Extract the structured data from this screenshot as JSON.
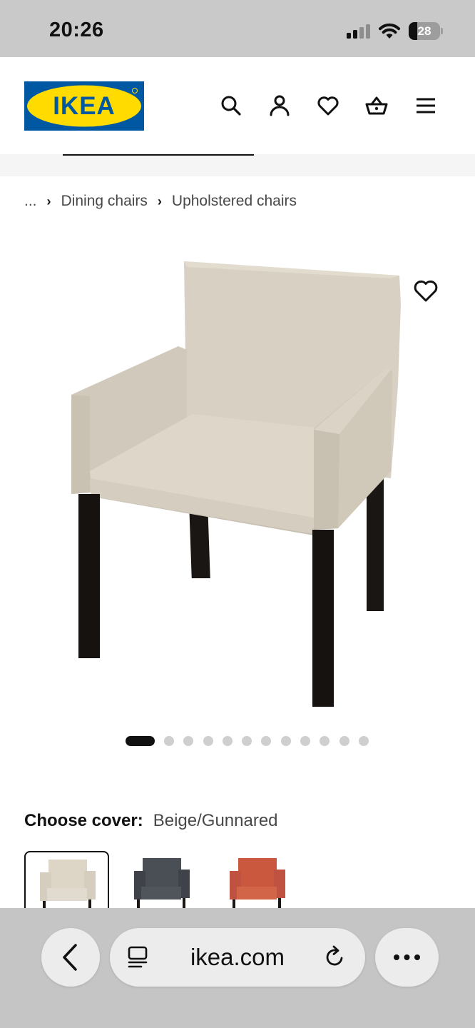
{
  "status_bar": {
    "time": "20:26",
    "battery_level": "28",
    "battery_fraction": 0.28,
    "signal_bars_active": 2,
    "signal_bars_total": 4
  },
  "header": {
    "logo_text": "IKEA",
    "brand_colors": {
      "blue": "#0058a3",
      "yellow": "#ffdb00"
    },
    "icons": [
      "search-icon",
      "account-icon",
      "heart-icon",
      "basket-icon",
      "menu-icon"
    ]
  },
  "breadcrumb": {
    "items": [
      "...",
      "Dining chairs",
      "Upholstered chairs"
    ]
  },
  "product": {
    "image_name": "upholstered-armchair-beige",
    "carousel_total": 12,
    "carousel_active_index": 0
  },
  "cover": {
    "label": "Choose cover:",
    "value": "Beige/Gunnared",
    "options": [
      {
        "name": "beige",
        "color": "#ddd5c6",
        "selected": true
      },
      {
        "name": "dark-grey",
        "color": "#3f4349",
        "selected": false
      },
      {
        "name": "red",
        "color": "#c55440",
        "selected": false
      }
    ]
  },
  "browser": {
    "url": "ikea.com"
  }
}
